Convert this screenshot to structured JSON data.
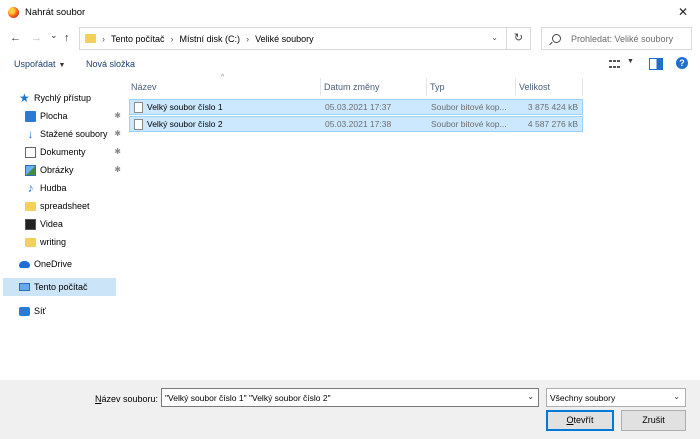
{
  "window": {
    "title": "Nahrát soubor",
    "close_glyph": "✕"
  },
  "nav": {
    "back_glyph": "←",
    "forward_glyph": "→",
    "recent_glyph": "⌄",
    "up_glyph": "↑",
    "breadcrumbs": [
      "Tento počítač",
      "Místní disk (C:)",
      "Veliké soubory"
    ],
    "separator": "›",
    "refresh_glyph": "↻"
  },
  "search": {
    "placeholder": "Prohledat: Veliké soubory"
  },
  "toolbar": {
    "organize_label": "Uspořádat",
    "new_folder_label": "Nová složka",
    "help_label": "?"
  },
  "sidebar": {
    "items": [
      {
        "label": "Rychlý přístup",
        "icon": "star-icon"
      },
      {
        "label": "Plocha",
        "icon": "desktop-icon",
        "pinned": true
      },
      {
        "label": "Stažené soubory",
        "icon": "download-icon",
        "pinned": true
      },
      {
        "label": "Dokumenty",
        "icon": "document-icon",
        "pinned": true
      },
      {
        "label": "Obrázky",
        "icon": "pictures-icon",
        "pinned": true
      },
      {
        "label": "Hudba",
        "icon": "music-icon"
      },
      {
        "label": "spreadsheet",
        "icon": "folder-icon"
      },
      {
        "label": "Videa",
        "icon": "video-icon"
      },
      {
        "label": "writing",
        "icon": "folder-icon"
      },
      {
        "label": "OneDrive",
        "icon": "cloud-icon"
      },
      {
        "label": "Tento počítač",
        "icon": "computer-icon",
        "selected": true
      },
      {
        "label": "Síť",
        "icon": "network-icon"
      }
    ],
    "pin_glyph": "📌"
  },
  "columns": {
    "name": "Název",
    "date": "Datum změny",
    "type": "Typ",
    "size": "Velikost"
  },
  "files": [
    {
      "name": "Velký soubor číslo 1",
      "date": "05.03.2021 17:37",
      "type": "Soubor bitové kop...",
      "size": "3 875 424 kB"
    },
    {
      "name": "Velký soubor číslo 2",
      "date": "05.03.2021 17:38",
      "type": "Soubor bitové kop...",
      "size": "4 587 276 kB"
    }
  ],
  "footer": {
    "filename_label_mnemonic": "N",
    "filename_label_rest": "ázev souboru:",
    "filename_value": "\"Velký soubor číslo 1\" \"Velký soubor číslo 2\"",
    "filter_value": "Všechny soubory",
    "open_mnemonic": "O",
    "open_rest": "tevřít",
    "cancel_label": "Zrušit"
  },
  "colors": {
    "selection_fill": "#cce8ff",
    "selection_border": "#99d1ff",
    "accent": "#0078d7"
  }
}
